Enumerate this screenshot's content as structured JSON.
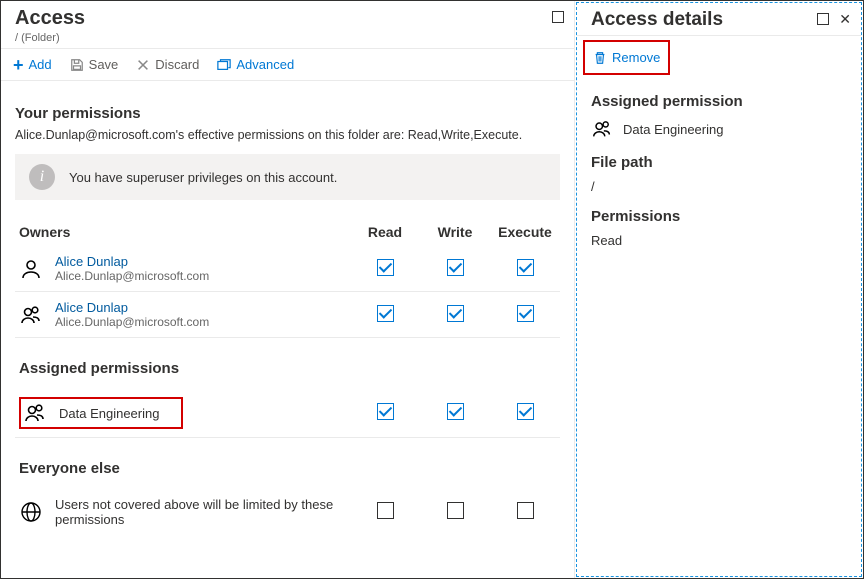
{
  "left": {
    "title": "Access",
    "breadcrumb": "/ (Folder)",
    "toolbar": {
      "add": "Add",
      "save": "Save",
      "discard": "Discard",
      "advanced": "Advanced"
    },
    "permSection": {
      "heading": "Your permissions",
      "sub": "Alice.Dunlap@microsoft.com's effective permissions on this folder are: Read,Write,Execute.",
      "info": "You have superuser privileges on this account."
    },
    "cols": {
      "owners": "Owners",
      "read": "Read",
      "write": "Write",
      "execute": "Execute"
    },
    "owners": [
      {
        "name": "Alice Dunlap",
        "email": "Alice.Dunlap@microsoft.com",
        "read": true,
        "write": true,
        "execute": true,
        "icon": "single"
      },
      {
        "name": "Alice Dunlap",
        "email": "Alice.Dunlap@microsoft.com",
        "read": true,
        "write": true,
        "execute": true,
        "icon": "group"
      }
    ],
    "assignedHeading": "Assigned permissions",
    "assigned": [
      {
        "name": "Data Engineering",
        "read": true,
        "write": true,
        "execute": true,
        "icon": "group",
        "highlight": true
      }
    ],
    "everyoneHeading": "Everyone else",
    "everyone": {
      "text": "Users not covered above will be limited by these permissions",
      "read": false,
      "write": false,
      "execute": false
    }
  },
  "right": {
    "title": "Access details",
    "remove": "Remove",
    "assignedHeading": "Assigned permission",
    "assignedName": "Data Engineering",
    "filePathHeading": "File path",
    "filePath": "/",
    "permHeading": "Permissions",
    "permValue": "Read"
  }
}
